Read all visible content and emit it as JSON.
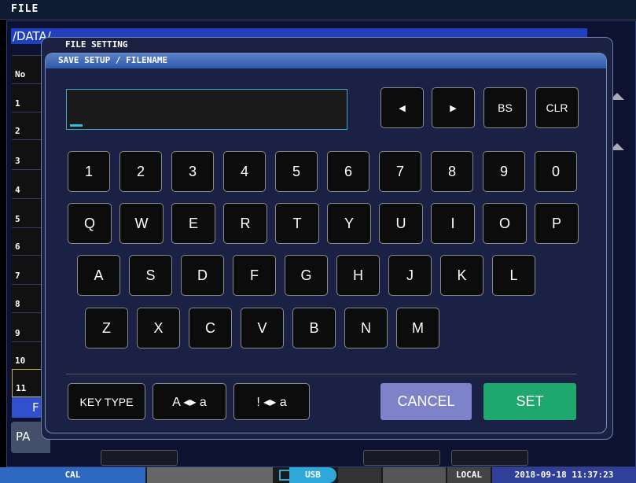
{
  "header": {
    "menu_label": "FILE"
  },
  "file_window": {
    "path": "/DATA/",
    "col_no": "No",
    "rows": [
      "1",
      "2",
      "3",
      "4",
      "5",
      "6",
      "7",
      "8",
      "9",
      "10",
      "11"
    ],
    "f_label": "F",
    "pa_label": "PA"
  },
  "dialog": {
    "outer_title": "FILE SETTING",
    "inner_title": "SAVE SETUP / FILENAME",
    "filename_value": ""
  },
  "nav_keys": {
    "left": "◀",
    "right": "▶",
    "bs": "BS",
    "clr": "CLR"
  },
  "keyboard": {
    "row1": [
      "1",
      "2",
      "3",
      "4",
      "5",
      "6",
      "7",
      "8",
      "9",
      "0"
    ],
    "row2": [
      "Q",
      "W",
      "E",
      "R",
      "T",
      "Y",
      "U",
      "I",
      "O",
      "P"
    ],
    "row3": [
      "A",
      "S",
      "D",
      "F",
      "G",
      "H",
      "J",
      "K",
      "L"
    ],
    "row4": [
      "Z",
      "X",
      "C",
      "V",
      "B",
      "N",
      "M"
    ]
  },
  "bottom": {
    "key_type": "KEY TYPE",
    "case_toggle": "A ◂▸ a",
    "symbol_toggle": "! ◂▸ a",
    "cancel": "CANCEL",
    "set": "SET"
  },
  "statusbar": {
    "cal": "CAL",
    "usb": "USB",
    "local": "LOCAL",
    "datetime": "2018-09-18 11:37:23"
  },
  "colors": {
    "cancel": "#7e82c8",
    "set": "#1ea86e",
    "accent": "#2ec0e0"
  }
}
